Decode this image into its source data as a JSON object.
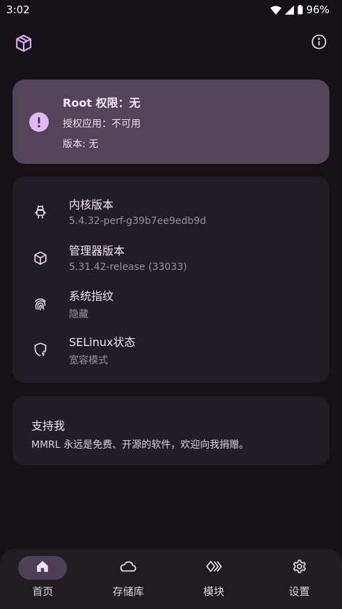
{
  "status_bar": {
    "time": "3:02",
    "battery": "96%",
    "icons": [
      "wifi-icon",
      "signal-icon",
      "battery-icon"
    ]
  },
  "top_bar": {
    "app_icon": "cube-logo-icon",
    "info_icon": "info-icon"
  },
  "status_card": {
    "icon": "warning-icon",
    "root_line": "Root 权限：无",
    "auth_line": "授权应用：不可用",
    "version_line": "版本: 无",
    "color": "#514557"
  },
  "info_card": {
    "items": [
      {
        "icon": "android-icon",
        "title": "内核版本",
        "value": "5.4.32-perf-g39b7ee9edb9d"
      },
      {
        "icon": "cube-icon",
        "title": "管理器版本",
        "value": "5.31.42-release (33033)"
      },
      {
        "icon": "fingerprint-icon",
        "title": "系统指纹",
        "value": "隐藏"
      },
      {
        "icon": "shield-icon",
        "title": "SELinux状态",
        "value": "宽容模式"
      }
    ]
  },
  "support_card": {
    "title": "支持我",
    "description": "MMRL 永远是免费、开源的软件，欢迎向我捐赠。"
  },
  "bottom_nav": {
    "items": [
      {
        "icon": "home-icon",
        "label": "首页",
        "active": true
      },
      {
        "icon": "cloud-icon",
        "label": "存储库",
        "active": false
      },
      {
        "icon": "modules-icon",
        "label": "模块",
        "active": false
      },
      {
        "icon": "gear-icon",
        "label": "设置",
        "active": false
      }
    ]
  },
  "colors": {
    "background": "#151117",
    "card": "#221d24",
    "accent": "#e2b9f5"
  }
}
